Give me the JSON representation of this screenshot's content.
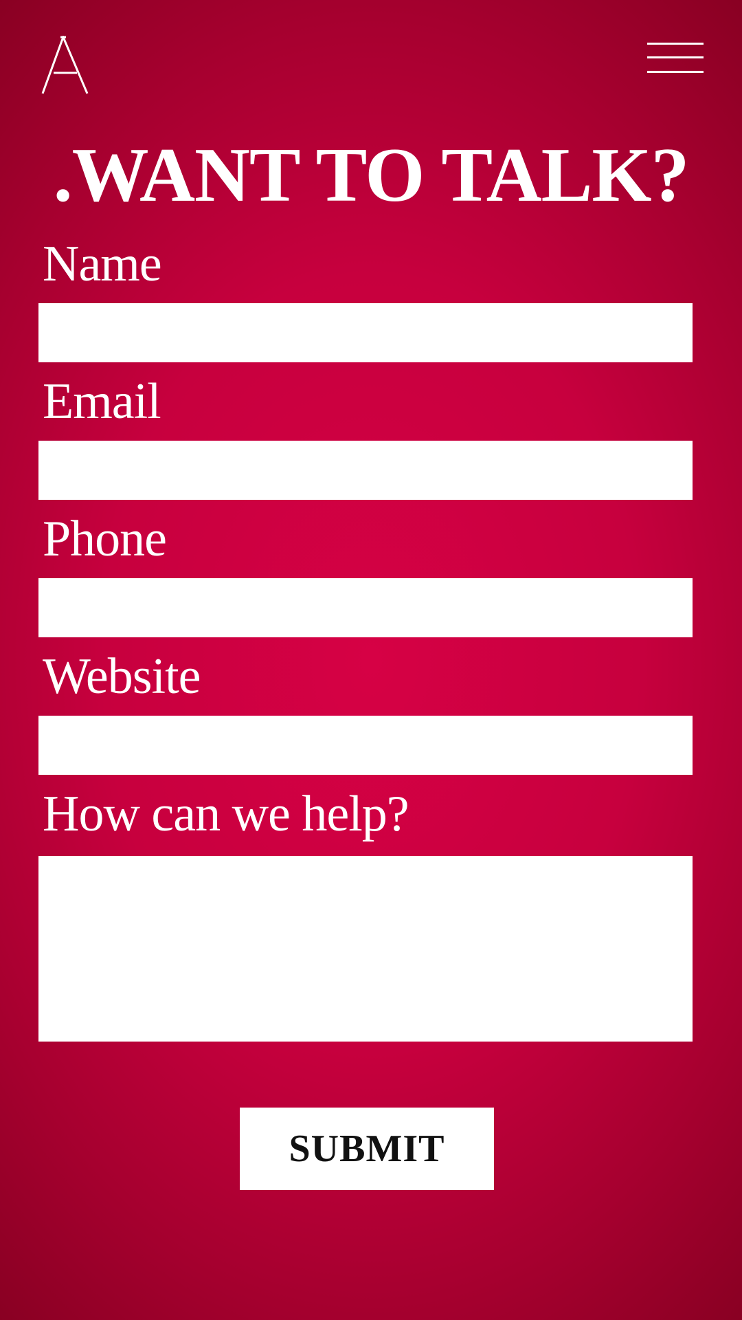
{
  "header": {
    "logo_icon": "serif-letter-a-logo-icon",
    "menu_icon": "hamburger-menu-icon"
  },
  "title": ".WANT TO TALK?",
  "form": {
    "name_label": "Name",
    "name_value": "",
    "email_label": "Email",
    "email_value": "",
    "phone_label": "Phone",
    "phone_value": "",
    "website_label": "Website",
    "website_value": "",
    "help_label": "How can we help?",
    "help_value": "",
    "submit_label": "SUBMIT"
  },
  "colors": {
    "background_center": "#d60145",
    "background_edge": "#880022",
    "text": "#ffffff",
    "field_background": "#ffffff",
    "button_text": "#111111"
  }
}
